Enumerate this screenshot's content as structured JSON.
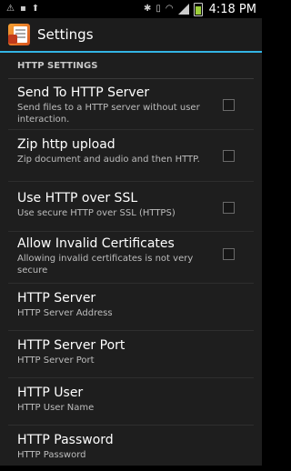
{
  "status_bar": {
    "time": "4:18 PM",
    "left_icons": [
      "notification-warning-icon",
      "image-icon",
      "upload-icon"
    ],
    "right_icons": [
      "bluetooth-icon",
      "vibrate-icon",
      "wifi-icon",
      "signal-icon",
      "battery-icon"
    ]
  },
  "action_bar": {
    "title": "Settings",
    "app_icon": "app-document-icon"
  },
  "section": {
    "header": "HTTP SETTINGS"
  },
  "preferences": [
    {
      "title": "Send To HTTP Server",
      "summary": "Send files to a HTTP server without user interaction.",
      "checkbox": true,
      "checked": false
    },
    {
      "title": "Zip http upload",
      "summary": "Zip document and audio and then HTTP.",
      "checkbox": true,
      "checked": false
    },
    {
      "title": "Use HTTP over SSL",
      "summary": "Use secure HTTP over SSL (HTTPS)",
      "checkbox": true,
      "checked": false
    },
    {
      "title": "Allow Invalid Certificates",
      "summary": "Allowing invalid certificates is not very secure",
      "checkbox": true,
      "checked": false
    },
    {
      "title": "HTTP Server",
      "summary": "HTTP Server Address",
      "checkbox": false
    },
    {
      "title": "HTTP Server Port",
      "summary": "HTTP Server Port",
      "checkbox": false
    },
    {
      "title": "HTTP User",
      "summary": "HTTP User Name",
      "checkbox": false
    },
    {
      "title": "HTTP Password",
      "summary": "HTTP Password",
      "checkbox": false
    }
  ],
  "colors": {
    "accent": "#33b5e5",
    "background": "#1e1e1e",
    "action_bar": "#1c1c1c"
  }
}
